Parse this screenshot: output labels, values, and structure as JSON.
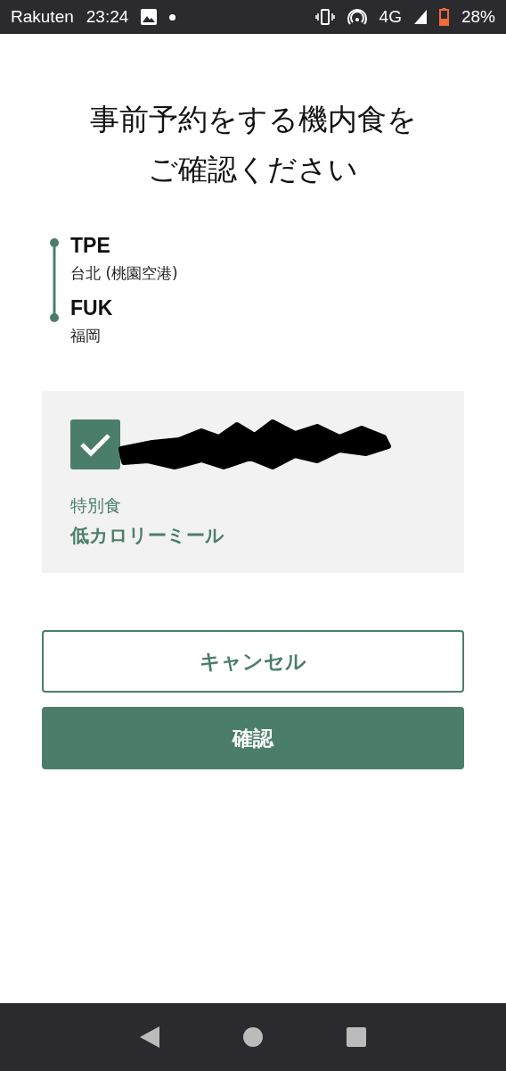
{
  "status_bar": {
    "carrier": "Rakuten",
    "time": "23:24",
    "network": "4G",
    "battery": "28%"
  },
  "title": [
    "事前予約をする機内食を",
    "ご確認ください"
  ],
  "route": [
    {
      "code": "TPE",
      "city": "台北 (桃園空港)"
    },
    {
      "code": "FUK",
      "city": "福岡"
    }
  ],
  "meal_card": {
    "checked": true,
    "category": "特別食",
    "meal": "低カロリーミール"
  },
  "buttons": [
    {
      "kind": "secondary",
      "label": "キャンセル"
    },
    {
      "kind": "primary",
      "label": "確認"
    }
  ]
}
